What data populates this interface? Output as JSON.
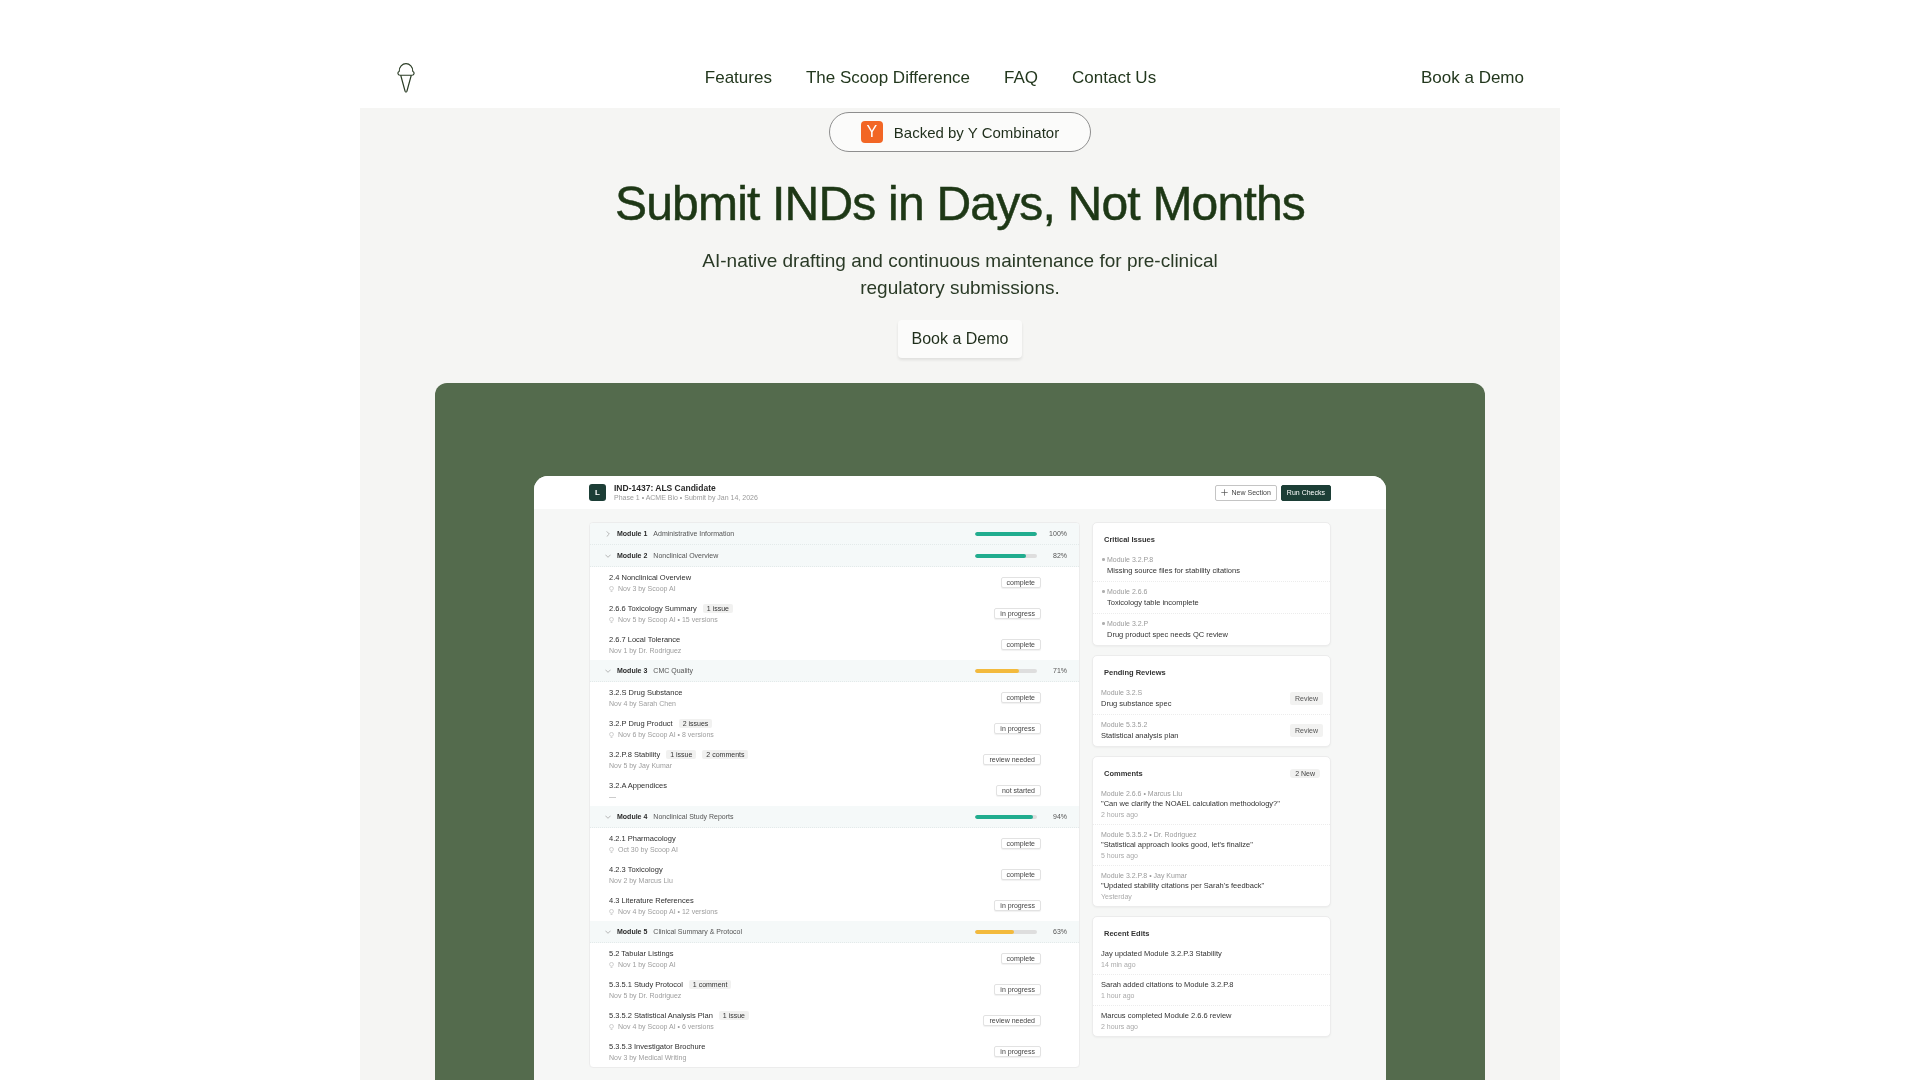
{
  "header": {
    "nav": [
      {
        "label": "Features"
      },
      {
        "label": "The Scoop Difference"
      },
      {
        "label": "FAQ"
      },
      {
        "label": "Contact Us"
      }
    ],
    "cta": "Book a Demo"
  },
  "hero": {
    "badge": {
      "logo_letter": "Y",
      "label": "Backed by Y Combinator"
    },
    "title": "Submit INDs in Days, Not Months",
    "subtitle": "AI-native drafting and continuous maintenance for pre-clinical regulatory submissions.",
    "button": "Book a Demo"
  },
  "app": {
    "logo_letter": "L",
    "title": "IND-1437: ALS Candidate",
    "subtitle": "Phase 1 • ACME Bio • Submit by Jan 14, 2026",
    "buttons": [
      {
        "label": "New Section",
        "kind": "add"
      },
      {
        "label": "Run Checks",
        "kind": "primary"
      }
    ],
    "modules": [
      {
        "name": "Module 1",
        "description": "Administrative Information",
        "level": 1.0,
        "color": "#21ad8f",
        "percent": "100%",
        "expanded": false
      },
      {
        "name": "Module 2",
        "description": "Nonclinical Overview",
        "level": 0.82,
        "color": "#21ad8f",
        "percent": "82%",
        "expanded": true,
        "sections": [
          {
            "title": "2.4 Nonclinical Overview",
            "ai": true,
            "meta": "Nov 3 by Scoop AI",
            "status": "complete"
          },
          {
            "title": "2.6.6 Toxicology Summary",
            "tags": [
              "1 issue"
            ],
            "ai": true,
            "meta": "Nov 5 by Scoop AI • 15 versions",
            "status": "in progress"
          },
          {
            "title": "2.6.7 Local Tolerance",
            "ai": false,
            "meta": "Nov 1 by Dr. Rodriguez",
            "status": "complete"
          }
        ]
      },
      {
        "name": "Module 3",
        "description": "CMC Quality",
        "level": 0.71,
        "color": "#f3ba3d",
        "percent": "71%",
        "expanded": true,
        "sections": [
          {
            "title": "3.2.S Drug Substance",
            "ai": false,
            "meta": "Nov 4 by Sarah Chen",
            "status": "complete"
          },
          {
            "title": "3.2.P Drug Product",
            "tags": [
              "2 issues"
            ],
            "ai": true,
            "meta": "Nov 6 by Scoop AI • 8 versions",
            "status": "in progress"
          },
          {
            "title": "3.2.P.8 Stability",
            "tags": [
              "1 issue",
              "2 comments"
            ],
            "ai": false,
            "meta": "Nov 5 by Jay Kumar",
            "status": "review needed"
          },
          {
            "title": "3.2.A Appendices",
            "ai": false,
            "meta": "—",
            "status": "not started"
          }
        ]
      },
      {
        "name": "Module 4",
        "description": "Nonclinical Study Reports",
        "level": 0.94,
        "color": "#21ad8f",
        "percent": "94%",
        "expanded": true,
        "sections": [
          {
            "title": "4.2.1 Pharmacology",
            "ai": true,
            "meta": "Oct 30 by Scoop AI",
            "status": "complete"
          },
          {
            "title": "4.2.3 Toxicology",
            "ai": false,
            "meta": "Nov 2 by Marcus Liu",
            "status": "complete"
          },
          {
            "title": "4.3 Literature References",
            "ai": true,
            "meta": "Nov 4 by Scoop AI • 12 versions",
            "status": "in progress"
          }
        ]
      },
      {
        "name": "Module 5",
        "description": "Clinical Summary & Protocol",
        "level": 0.63,
        "color": "#f3ba3d",
        "percent": "63%",
        "expanded": true,
        "sections": [
          {
            "title": "5.2 Tabular Listings",
            "ai": true,
            "meta": "Nov 1 by Scoop AI",
            "status": "complete"
          },
          {
            "title": "5.3.5.1 Study Protocol",
            "tags": [
              "1 comment"
            ],
            "ai": false,
            "meta": "Nov 5 by Dr. Rodriguez",
            "status": "in progress"
          },
          {
            "title": "5.3.5.2 Statistical Analysis Plan",
            "tags": [
              "1 issue"
            ],
            "ai": true,
            "meta": "Nov 4 by Scoop AI • 6 versions",
            "status": "review needed"
          },
          {
            "title": "5.3.5.3 Investigator Brochure",
            "ai": false,
            "meta": "Nov 3 by Medical Writing",
            "status": "in progress"
          }
        ]
      }
    ],
    "critical_issues": {
      "title": "Critical Issues",
      "items": [
        {
          "module": "Module 3.2.P.8",
          "text": "Missing source files for stability citations"
        },
        {
          "module": "Module 2.6.6",
          "text": "Toxicology table incomplete"
        },
        {
          "module": "Module 3.2.P",
          "text": "Drug product spec needs QC review"
        }
      ]
    },
    "pending_reviews": {
      "title": "Pending Reviews",
      "items": [
        {
          "module": "Module 3.2.S",
          "text": "Drug substance spec",
          "action": "Review"
        },
        {
          "module": "Module 5.3.5.2",
          "text": "Statistical analysis plan",
          "action": "Review"
        }
      ]
    },
    "comments": {
      "title": "Comments",
      "badge": "2 New",
      "items": [
        {
          "meta": "Module 2.6.6 • Marcus Liu",
          "quote": "\"Can we clarify the NOAEL calculation methodology?\"",
          "time": "2 hours ago"
        },
        {
          "meta": "Module 5.3.5.2 • Dr. Rodriguez",
          "quote": "\"Statistical approach looks good, let's finalize\"",
          "time": "5 hours ago"
        },
        {
          "meta": "Module 3.2.P.8 • Jay Kumar",
          "quote": "\"Updated stability citations per Sarah's feedback\"",
          "time": "Yesterday"
        }
      ]
    },
    "recent_edits": {
      "title": "Recent Edits",
      "items": [
        {
          "text": "Jay updated Module 3.2.P.3 Stability",
          "time": "14 min ago"
        },
        {
          "text": "Sarah added citations to Module 3.2.P.8",
          "time": "1 hour ago"
        },
        {
          "text": "Marcus completed Module 2.6.6 review",
          "time": "2 hours ago"
        }
      ]
    }
  }
}
